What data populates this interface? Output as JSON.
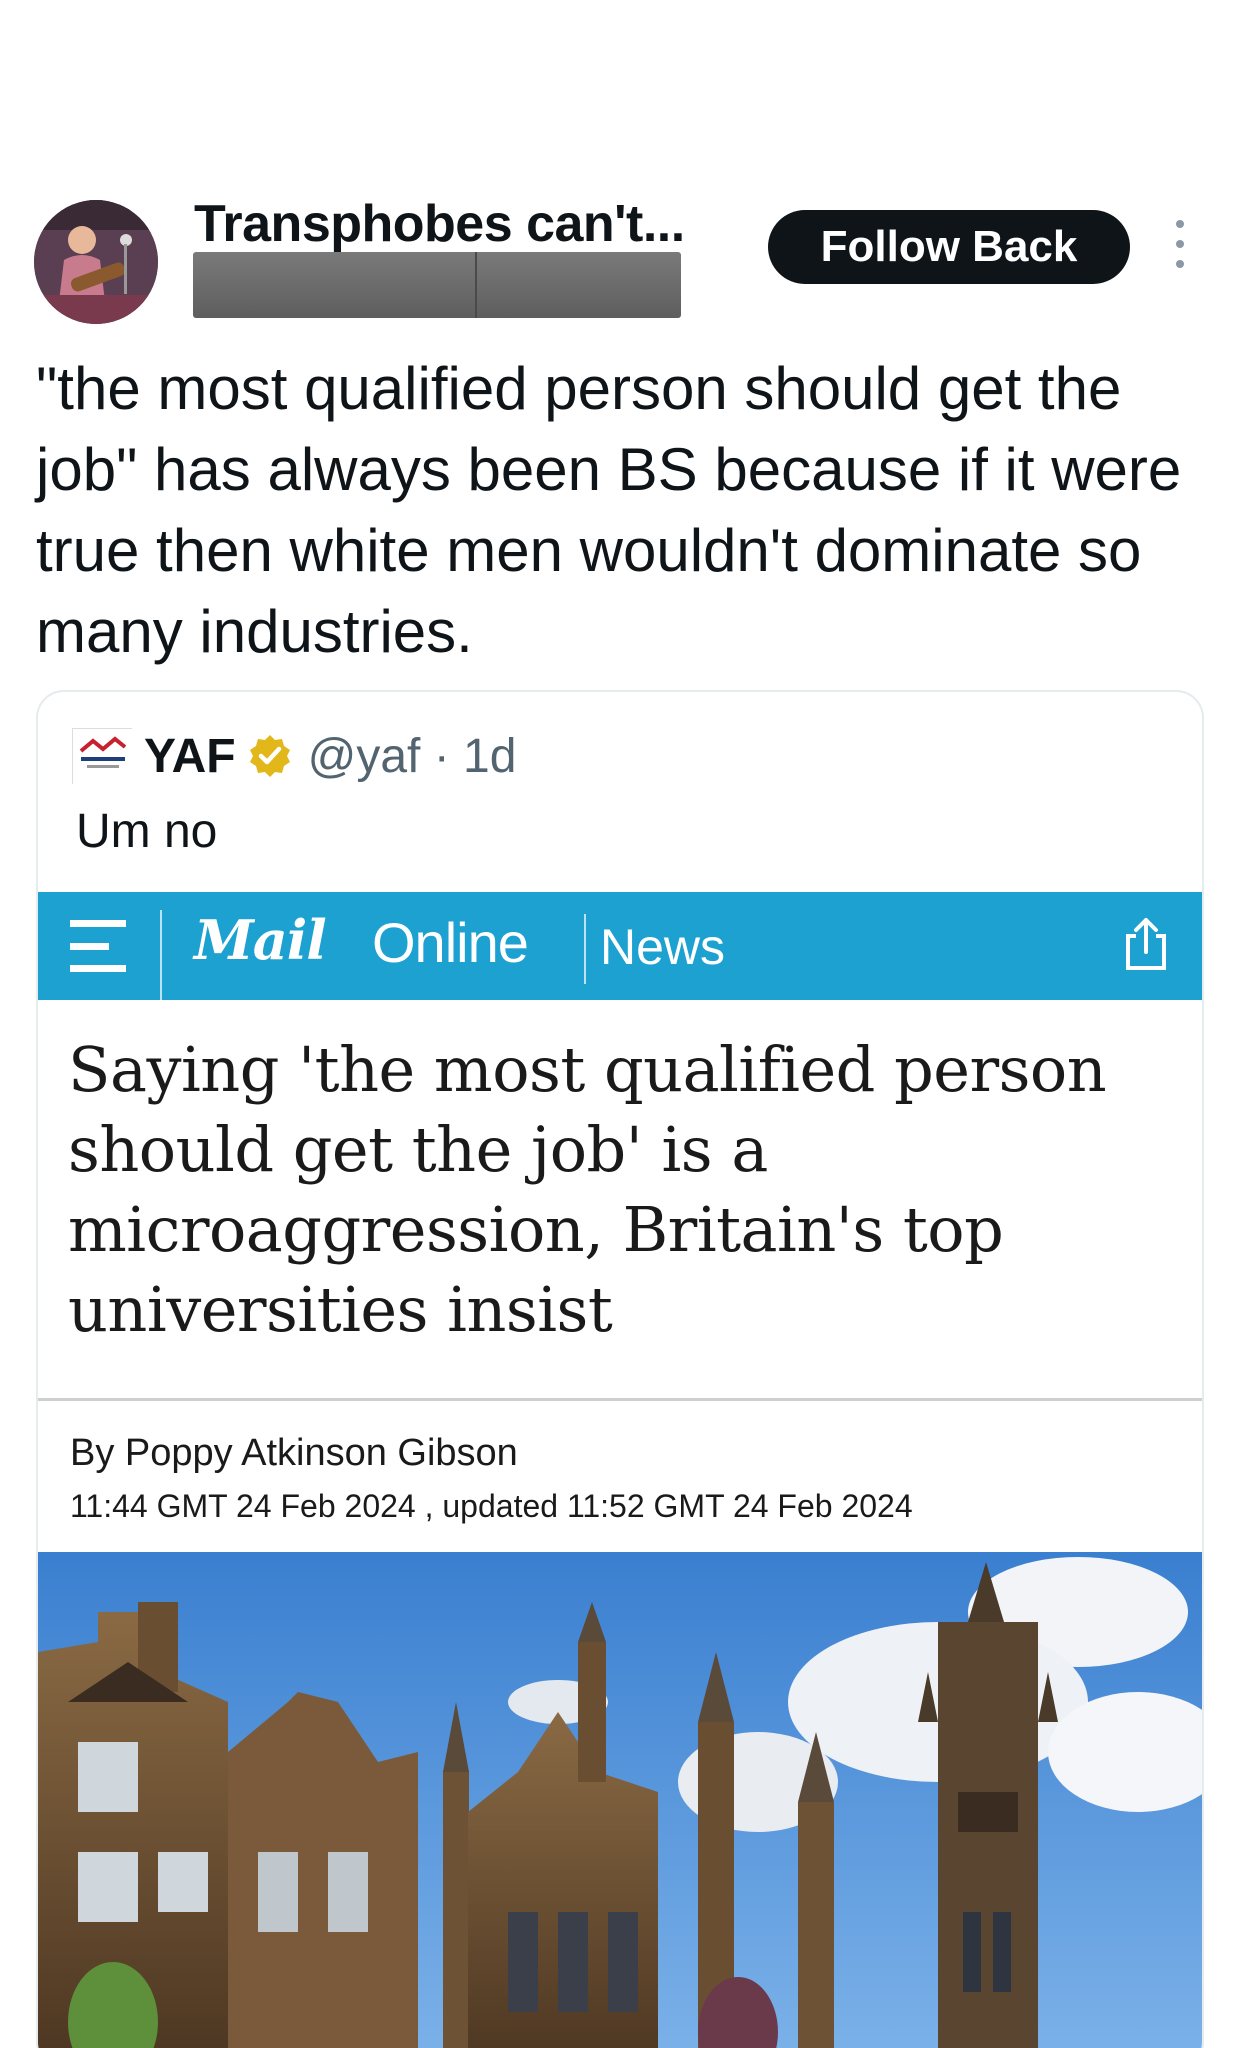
{
  "post": {
    "display_name": "Transphobes can't...",
    "follow_label": "Follow Back",
    "text": "\"the most qualified person should get the job\" has always been BS because if it were true then white men wouldn't dominate so many industries."
  },
  "quote": {
    "name": "YAF",
    "handle": "@yaf · 1d",
    "text": "Um no",
    "article": {
      "brand_mail": "Mail",
      "brand_online": "Online",
      "section": "News",
      "headline": "Saying 'the most qualified person should get the job' is a microaggression, Britain's top universities insist",
      "byline": "By Poppy Atkinson Gibson",
      "dateline": "11:44 GMT 24 Feb 2024 , updated 11:52 GMT 24 Feb 2024"
    }
  },
  "colors": {
    "follow_button_bg": "#0f1419",
    "mail_bar": "#1ca1d1",
    "verified_badge": "#e2b719"
  },
  "icons": [
    "more-options-icon",
    "verified-badge-icon",
    "hamburger-menu-icon",
    "share-icon"
  ]
}
